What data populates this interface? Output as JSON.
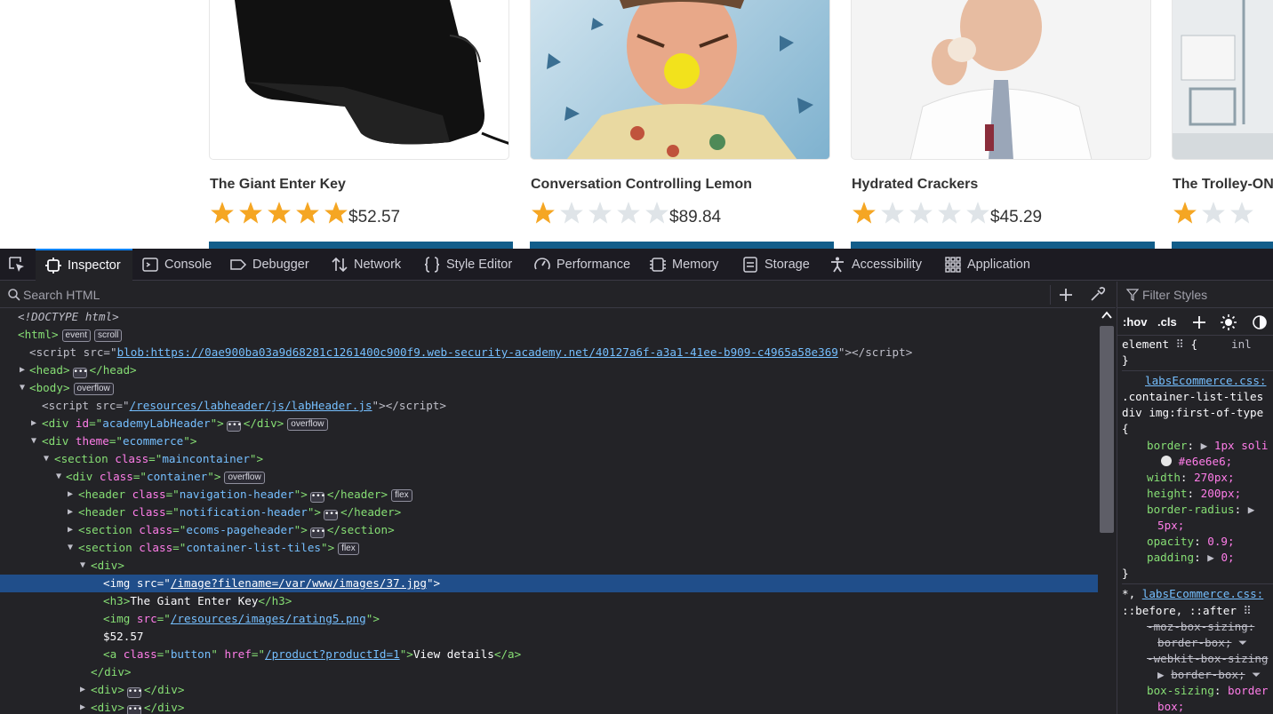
{
  "page": {
    "products": [
      {
        "name": "The Giant Enter Key",
        "price": "$52.57",
        "rating": 5
      },
      {
        "name": "Conversation Controlling Lemon",
        "price": "$89.84",
        "rating": 1
      },
      {
        "name": "Hydrated Crackers",
        "price": "$45.29",
        "rating": 1
      },
      {
        "name": "The Trolley-ON",
        "price": "",
        "rating": 1
      }
    ]
  },
  "devtools": {
    "tabs": [
      {
        "label": "Inspector",
        "icon": "inspector-icon"
      },
      {
        "label": "Console",
        "icon": "console-icon"
      },
      {
        "label": "Debugger",
        "icon": "debugger-icon"
      },
      {
        "label": "Network",
        "icon": "network-icon"
      },
      {
        "label": "Style Editor",
        "icon": "style-editor-icon"
      },
      {
        "label": "Performance",
        "icon": "performance-icon"
      },
      {
        "label": "Memory",
        "icon": "memory-icon"
      },
      {
        "label": "Storage",
        "icon": "storage-icon"
      },
      {
        "label": "Accessibility",
        "icon": "accessibility-icon"
      },
      {
        "label": "Application",
        "icon": "application-icon"
      }
    ],
    "active_tab": "Inspector",
    "search_placeholder": "Search HTML",
    "tree": {
      "l0": "<!DOCTYPE html>",
      "l1_tag": "html",
      "l1_badges": [
        "event",
        "scroll"
      ],
      "l2_attr": "src",
      "l2_val": "blob:https://0ae900ba03a9d68281c1261400c900f9.web-security-academy.net/40127a6f-a3a1-41ee-b909-c4965a58e369",
      "l3_tag": "head",
      "l4_tag": "body",
      "l4_badge": "overflow",
      "l5_val": "/resources/labheader/js/labHeader.js",
      "l6_val": "academyLabHeader",
      "l6_badge": "overflow",
      "l7_val": "ecommerce",
      "l8_val": "maincontainer",
      "l9_val": "container",
      "l9_badge": "overflow",
      "l10_val": "navigation-header",
      "l10_badge": "flex",
      "l11_val": "notification-header",
      "l12_val": "ecoms-pageheader",
      "l13_val": "container-list-tiles",
      "l13_badge": "flex",
      "l15_val": "/image?filename=/var/www/images/37.jpg",
      "l16_text": "The Giant Enter Key",
      "l17_val": "/resources/images/rating5.png",
      "l18_text": "$52.57",
      "l19_class": "button",
      "l19_href": "/product?productId=1",
      "l19_text": "View details"
    },
    "rules": {
      "filter_placeholder": "Filter Styles",
      "hov": ":hov",
      "cls": ".cls",
      "element_label": "element",
      "inline_label": "inl",
      "source1": "labsEcommerce.css:",
      "selector1a": ".container-list-tiles",
      "selector1b": "div img:first-of-type",
      "decls1": [
        {
          "prop": "border",
          "val": "1px soli"
        },
        {
          "prop": "",
          "val": "#e6e6e6;"
        },
        {
          "prop": "width",
          "val": "270px;"
        },
        {
          "prop": "height",
          "val": "200px;"
        },
        {
          "prop": "border-radius",
          "val": ""
        },
        {
          "prop": "",
          "val": "5px;"
        },
        {
          "prop": "opacity",
          "val": "0.9;"
        },
        {
          "prop": "padding",
          "val": "0;"
        }
      ],
      "source2": "labsEcommerce.css:",
      "selector2a": "*,",
      "selector2b": "::before, ::after",
      "decls2": [
        {
          "text": "-moz-box-sizing:"
        },
        {
          "text": "border-box;"
        },
        {
          "text": "-webkit-box-sizing"
        },
        {
          "text": "border-box;"
        }
      ],
      "boxsizing_prop": "box-sizing",
      "boxsizing_val": "border",
      "boxsizing_val2": "box;"
    }
  }
}
